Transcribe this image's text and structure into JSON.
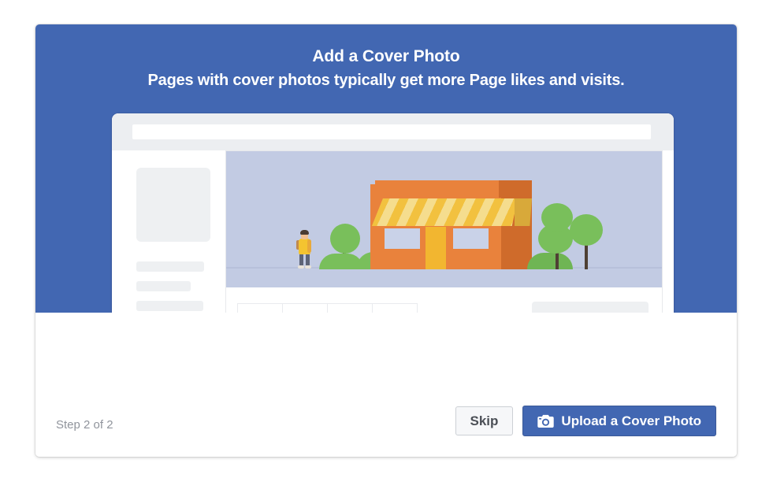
{
  "dialog": {
    "header": {
      "title": "Add a Cover Photo",
      "subtitle": "Pages with cover photos typically get more Page likes and visits."
    },
    "footer": {
      "step_label": "Step 2 of 2",
      "skip_label": "Skip",
      "upload_label": "Upload a Cover Photo",
      "upload_icon": "camera-icon"
    }
  },
  "illustration": {
    "alt": "wireframe-page-preview",
    "browser_url_bar": "",
    "tabs_count": 4,
    "scene": {
      "subject": "storefront-with-person-and-trees",
      "building": "orange-shop",
      "awning": "yellow-striped-awning",
      "person": "person-with-backpack"
    }
  },
  "colors": {
    "brand_blue": "#4267b2",
    "cover_placeholder": "#c2cbe3",
    "skip_bg": "#f6f7f9",
    "skip_border": "#ccd0d5",
    "step_text": "#90949c",
    "wireframe_grey": "#eef0f2",
    "browser_bar": "#eceef1",
    "shop_orange": "#e9823c",
    "shop_orange_dark": "#cf6b2b",
    "awning_yellow": "#f2c13f",
    "awning_cream": "#f5dd8e",
    "tree_green": "#79bf5b",
    "door_yellow": "#f2b630"
  }
}
